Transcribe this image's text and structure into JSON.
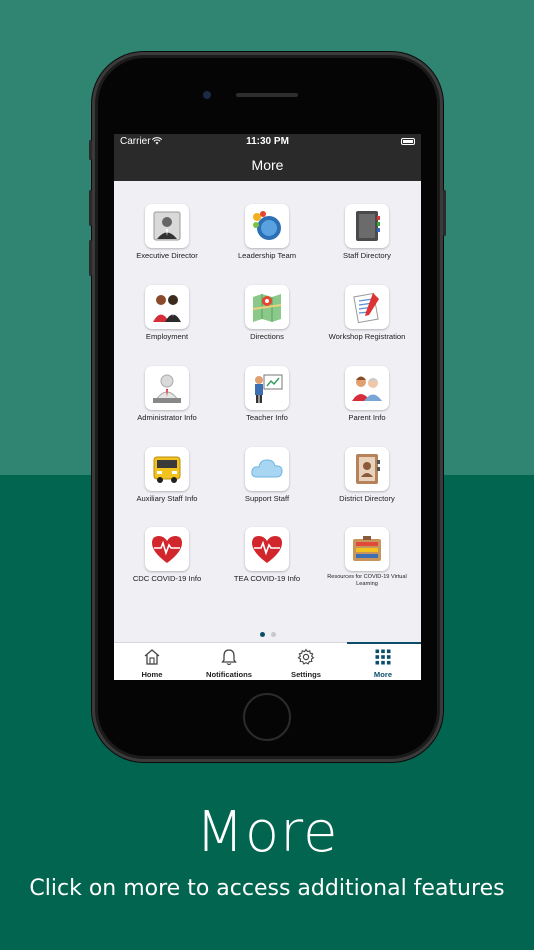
{
  "status": {
    "carrier": "Carrier",
    "time": "11:30 PM"
  },
  "nav": {
    "title": "More"
  },
  "grid_items": [
    {
      "label": "Executive Director",
      "icon": "executive-director-icon"
    },
    {
      "label": "Leadership Team",
      "icon": "leadership-team-icon"
    },
    {
      "label": "Staff Directory",
      "icon": "staff-directory-icon"
    },
    {
      "label": "Employment",
      "icon": "employment-icon"
    },
    {
      "label": "Directions",
      "icon": "directions-map-icon"
    },
    {
      "label": "Workshop Registration",
      "icon": "workshop-registration-icon"
    },
    {
      "label": "Administrator Info",
      "icon": "administrator-info-icon"
    },
    {
      "label": "Teacher Info",
      "icon": "teacher-info-icon"
    },
    {
      "label": "Parent Info",
      "icon": "parent-info-icon"
    },
    {
      "label": "Auxiliary Staff Info",
      "icon": "auxiliary-staff-bus-icon"
    },
    {
      "label": "Support Staff",
      "icon": "support-staff-cloud-icon"
    },
    {
      "label": "District Directory",
      "icon": "district-directory-icon"
    },
    {
      "label": "CDC COVID-19 Info",
      "icon": "cdc-covid-heart-icon"
    },
    {
      "label": "TEA COVID-19 Info",
      "icon": "tea-covid-heart-icon"
    },
    {
      "label": "Resources for COVID-19 Virtual Learning",
      "icon": "virtual-learning-resources-icon"
    }
  ],
  "pager": {
    "pages": 2,
    "current": 1
  },
  "tabs": [
    {
      "label": "Home",
      "icon": "home-icon"
    },
    {
      "label": "Notifications",
      "icon": "bell-icon"
    },
    {
      "label": "Settings",
      "icon": "gear-icon"
    },
    {
      "label": "More",
      "icon": "grid-icon"
    }
  ],
  "caption": {
    "title": "More",
    "subtitle": "Click on more to access additional features"
  },
  "colors": {
    "background_top": "#2f8472",
    "background_bottom": "#01654f",
    "accent": "#0d4d6a",
    "heart_red": "#d0262c"
  }
}
